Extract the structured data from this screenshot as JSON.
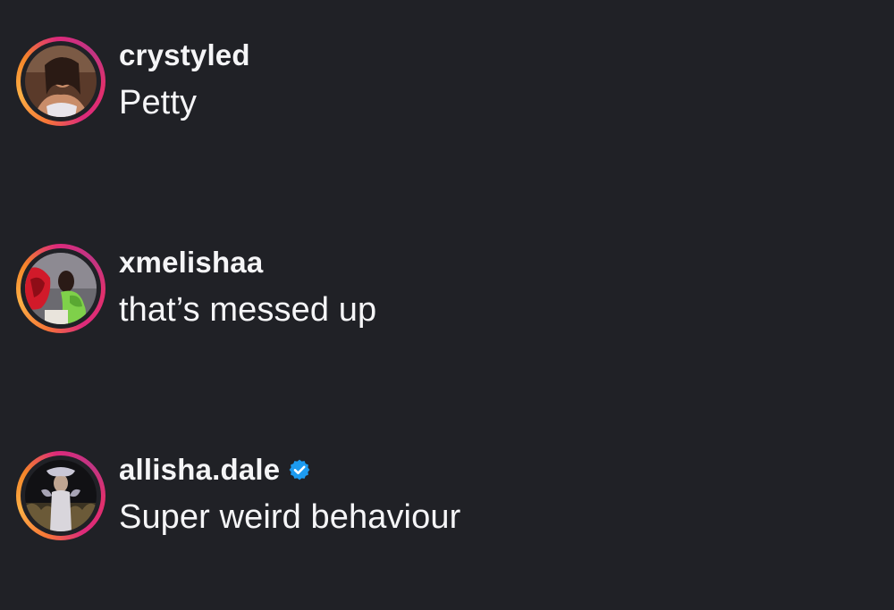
{
  "colors": {
    "background": "#202126",
    "text": "#f5f5f7",
    "verified_badge": "#1d9bf0"
  },
  "comments": [
    {
      "username": "crystyled",
      "text": "Petty",
      "verified": false,
      "avatar_icon": "profile-photo"
    },
    {
      "username": "xmelishaa",
      "text": "that’s messed up",
      "verified": false,
      "avatar_icon": "profile-photo"
    },
    {
      "username": "allisha.dale",
      "text": "Super weird behaviour",
      "verified": true,
      "avatar_icon": "profile-photo",
      "badge_icon": "verified-badge-icon"
    }
  ]
}
